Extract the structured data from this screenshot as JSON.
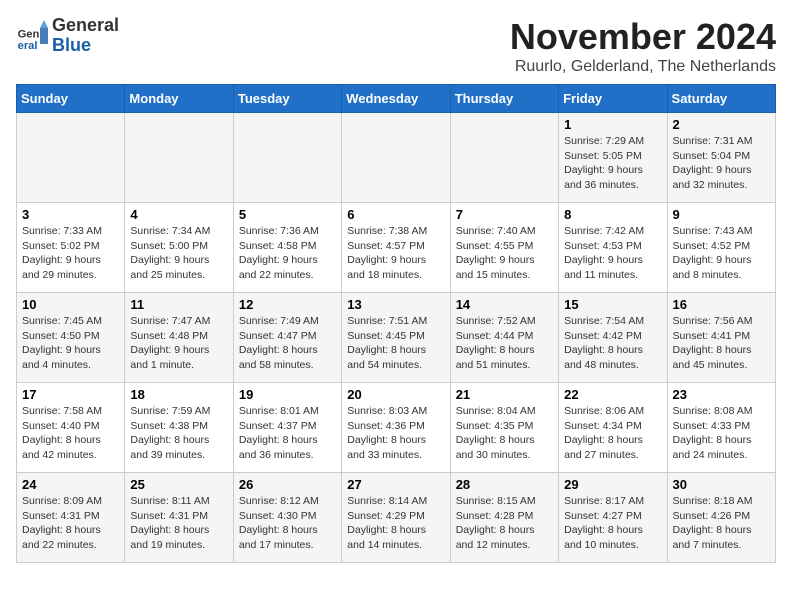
{
  "logo": {
    "general": "General",
    "blue": "Blue"
  },
  "title": "November 2024",
  "subtitle": "Ruurlo, Gelderland, The Netherlands",
  "days_of_week": [
    "Sunday",
    "Monday",
    "Tuesday",
    "Wednesday",
    "Thursday",
    "Friday",
    "Saturday"
  ],
  "weeks": [
    [
      {
        "day": "",
        "detail": ""
      },
      {
        "day": "",
        "detail": ""
      },
      {
        "day": "",
        "detail": ""
      },
      {
        "day": "",
        "detail": ""
      },
      {
        "day": "",
        "detail": ""
      },
      {
        "day": "1",
        "detail": "Sunrise: 7:29 AM\nSunset: 5:05 PM\nDaylight: 9 hours and 36 minutes."
      },
      {
        "day": "2",
        "detail": "Sunrise: 7:31 AM\nSunset: 5:04 PM\nDaylight: 9 hours and 32 minutes."
      }
    ],
    [
      {
        "day": "3",
        "detail": "Sunrise: 7:33 AM\nSunset: 5:02 PM\nDaylight: 9 hours and 29 minutes."
      },
      {
        "day": "4",
        "detail": "Sunrise: 7:34 AM\nSunset: 5:00 PM\nDaylight: 9 hours and 25 minutes."
      },
      {
        "day": "5",
        "detail": "Sunrise: 7:36 AM\nSunset: 4:58 PM\nDaylight: 9 hours and 22 minutes."
      },
      {
        "day": "6",
        "detail": "Sunrise: 7:38 AM\nSunset: 4:57 PM\nDaylight: 9 hours and 18 minutes."
      },
      {
        "day": "7",
        "detail": "Sunrise: 7:40 AM\nSunset: 4:55 PM\nDaylight: 9 hours and 15 minutes."
      },
      {
        "day": "8",
        "detail": "Sunrise: 7:42 AM\nSunset: 4:53 PM\nDaylight: 9 hours and 11 minutes."
      },
      {
        "day": "9",
        "detail": "Sunrise: 7:43 AM\nSunset: 4:52 PM\nDaylight: 9 hours and 8 minutes."
      }
    ],
    [
      {
        "day": "10",
        "detail": "Sunrise: 7:45 AM\nSunset: 4:50 PM\nDaylight: 9 hours and 4 minutes."
      },
      {
        "day": "11",
        "detail": "Sunrise: 7:47 AM\nSunset: 4:48 PM\nDaylight: 9 hours and 1 minute."
      },
      {
        "day": "12",
        "detail": "Sunrise: 7:49 AM\nSunset: 4:47 PM\nDaylight: 8 hours and 58 minutes."
      },
      {
        "day": "13",
        "detail": "Sunrise: 7:51 AM\nSunset: 4:45 PM\nDaylight: 8 hours and 54 minutes."
      },
      {
        "day": "14",
        "detail": "Sunrise: 7:52 AM\nSunset: 4:44 PM\nDaylight: 8 hours and 51 minutes."
      },
      {
        "day": "15",
        "detail": "Sunrise: 7:54 AM\nSunset: 4:42 PM\nDaylight: 8 hours and 48 minutes."
      },
      {
        "day": "16",
        "detail": "Sunrise: 7:56 AM\nSunset: 4:41 PM\nDaylight: 8 hours and 45 minutes."
      }
    ],
    [
      {
        "day": "17",
        "detail": "Sunrise: 7:58 AM\nSunset: 4:40 PM\nDaylight: 8 hours and 42 minutes."
      },
      {
        "day": "18",
        "detail": "Sunrise: 7:59 AM\nSunset: 4:38 PM\nDaylight: 8 hours and 39 minutes."
      },
      {
        "day": "19",
        "detail": "Sunrise: 8:01 AM\nSunset: 4:37 PM\nDaylight: 8 hours and 36 minutes."
      },
      {
        "day": "20",
        "detail": "Sunrise: 8:03 AM\nSunset: 4:36 PM\nDaylight: 8 hours and 33 minutes."
      },
      {
        "day": "21",
        "detail": "Sunrise: 8:04 AM\nSunset: 4:35 PM\nDaylight: 8 hours and 30 minutes."
      },
      {
        "day": "22",
        "detail": "Sunrise: 8:06 AM\nSunset: 4:34 PM\nDaylight: 8 hours and 27 minutes."
      },
      {
        "day": "23",
        "detail": "Sunrise: 8:08 AM\nSunset: 4:33 PM\nDaylight: 8 hours and 24 minutes."
      }
    ],
    [
      {
        "day": "24",
        "detail": "Sunrise: 8:09 AM\nSunset: 4:31 PM\nDaylight: 8 hours and 22 minutes."
      },
      {
        "day": "25",
        "detail": "Sunrise: 8:11 AM\nSunset: 4:31 PM\nDaylight: 8 hours and 19 minutes."
      },
      {
        "day": "26",
        "detail": "Sunrise: 8:12 AM\nSunset: 4:30 PM\nDaylight: 8 hours and 17 minutes."
      },
      {
        "day": "27",
        "detail": "Sunrise: 8:14 AM\nSunset: 4:29 PM\nDaylight: 8 hours and 14 minutes."
      },
      {
        "day": "28",
        "detail": "Sunrise: 8:15 AM\nSunset: 4:28 PM\nDaylight: 8 hours and 12 minutes."
      },
      {
        "day": "29",
        "detail": "Sunrise: 8:17 AM\nSunset: 4:27 PM\nDaylight: 8 hours and 10 minutes."
      },
      {
        "day": "30",
        "detail": "Sunrise: 8:18 AM\nSunset: 4:26 PM\nDaylight: 8 hours and 7 minutes."
      }
    ]
  ]
}
